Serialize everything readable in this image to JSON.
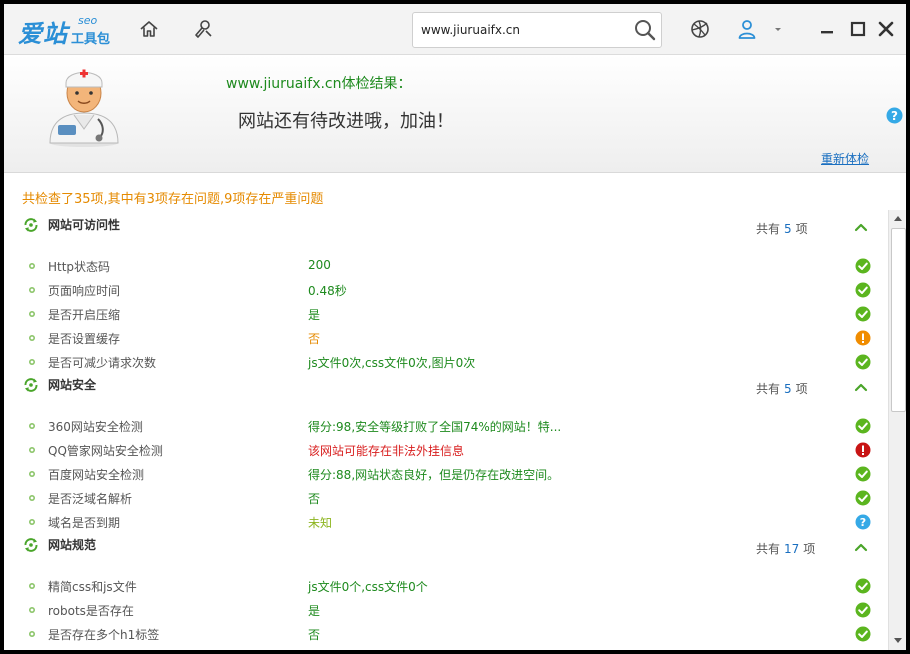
{
  "app": {
    "logo_main": "爱站",
    "logo_seo": "seo",
    "logo_sub": "工具包"
  },
  "search": {
    "value": "www.jiuruaifx.cn"
  },
  "header": {
    "result_title": "www.jiuruaifx.cn体检结果：",
    "result_message": "网站还有待改进哦，加油！",
    "recheck_label": "重新体检"
  },
  "summary": "共检查了35项,其中有3项存在问题,9项存在严重问题",
  "colors": {
    "accent": "#2b8fd6",
    "ok": "#5bb51f",
    "warn": "#f08c00",
    "error": "#d81e1e",
    "info": "#35a9e6"
  },
  "sections": [
    {
      "title": "网站可访问性",
      "count_prefix": "共有",
      "count": "5",
      "count_suffix": "项",
      "items": [
        {
          "label": "Http状态码",
          "value": "200",
          "tone": "green",
          "status": "ok"
        },
        {
          "label": "页面响应时间",
          "value": "0.48秒",
          "tone": "green",
          "status": "ok"
        },
        {
          "label": "是否开启压缩",
          "value": "是",
          "tone": "green",
          "status": "ok"
        },
        {
          "label": "是否设置缓存",
          "value": "否",
          "tone": "orange",
          "status": "warn"
        },
        {
          "label": "是否可减少请求次数",
          "value": "js文件0次,css文件0次,图片0次",
          "tone": "green",
          "status": "ok"
        }
      ]
    },
    {
      "title": "网站安全",
      "count_prefix": "共有",
      "count": "5",
      "count_suffix": "项",
      "items": [
        {
          "label": "360网站安全检测",
          "value": "得分:98,安全等级打败了全国74%的网站！特...",
          "tone": "green",
          "status": "ok"
        },
        {
          "label": "QQ管家网站安全检测",
          "value": "该网站可能存在非法外挂信息",
          "tone": "red",
          "status": "error"
        },
        {
          "label": "百度网站安全检测",
          "value": "得分:88,网站状态良好，但是仍存在改进空间。",
          "tone": "green",
          "status": "ok"
        },
        {
          "label": "是否泛域名解析",
          "value": "否",
          "tone": "green",
          "status": "ok"
        },
        {
          "label": "域名是否到期",
          "value": "未知",
          "tone": "olive",
          "status": "info"
        }
      ]
    },
    {
      "title": "网站规范",
      "count_prefix": "共有",
      "count": "17",
      "count_suffix": "项",
      "items": [
        {
          "label": "精简css和js文件",
          "value": "js文件0个,css文件0个",
          "tone": "green",
          "status": "ok"
        },
        {
          "label": "robots是否存在",
          "value": "是",
          "tone": "green",
          "status": "ok"
        },
        {
          "label": "是否存在多个h1标签",
          "value": "否",
          "tone": "green",
          "status": "ok"
        }
      ]
    }
  ]
}
